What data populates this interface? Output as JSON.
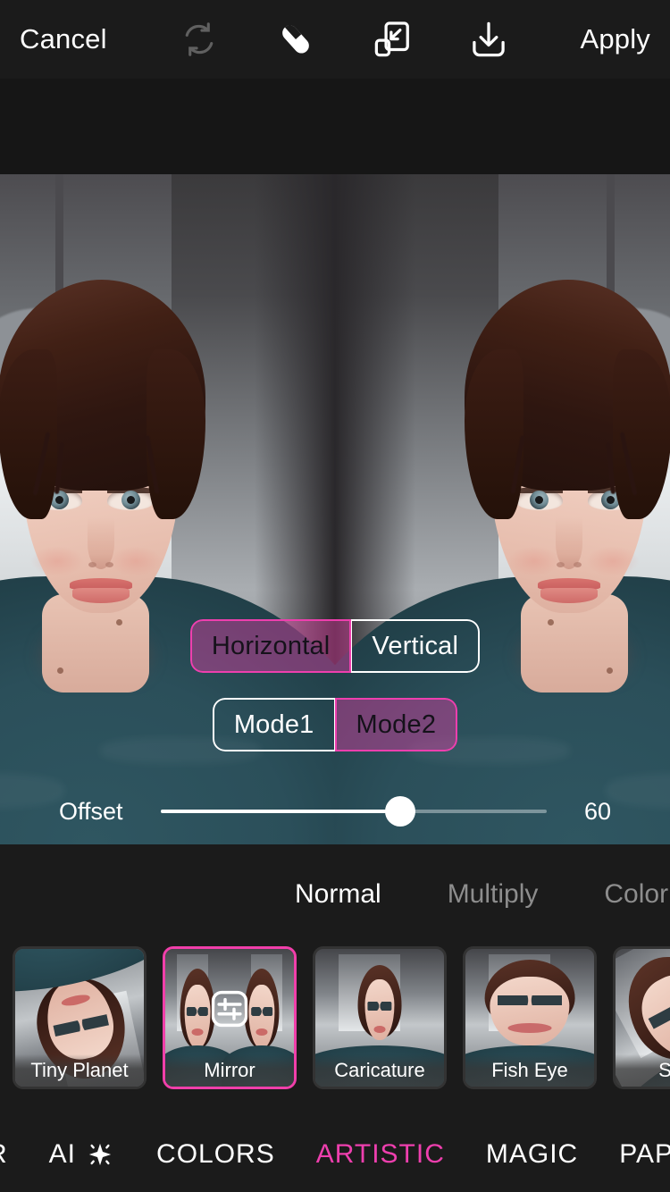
{
  "topbar": {
    "cancel_label": "Cancel",
    "apply_label": "Apply",
    "icons": [
      {
        "name": "reset-icon",
        "disabled": true
      },
      {
        "name": "eraser-icon",
        "disabled": false
      },
      {
        "name": "resize-icon",
        "disabled": false
      },
      {
        "name": "download-icon",
        "disabled": false
      }
    ]
  },
  "editor": {
    "effect_name": "Mirror",
    "orientation": {
      "options": [
        "Horizontal",
        "Vertical"
      ],
      "selected": "Horizontal"
    },
    "mode": {
      "options": [
        "Mode1",
        "Mode2"
      ],
      "selected": "Mode2"
    },
    "offset": {
      "label": "Offset",
      "value": 60,
      "display_value": "60",
      "min": 0,
      "max": 100,
      "percent": 62
    }
  },
  "blend_modes": {
    "items": [
      "Normal",
      "Multiply",
      "Color Bu"
    ],
    "selected": "Normal"
  },
  "filters": [
    {
      "label": "Tiny Planet",
      "selected": false
    },
    {
      "label": "Mirror",
      "selected": true,
      "badge": "sliders-icon"
    },
    {
      "label": "Caricature",
      "selected": false
    },
    {
      "label": "Fish Eye",
      "selected": false
    },
    {
      "label": "Swirl",
      "selected": false
    }
  ],
  "bottom_nav": {
    "items": [
      {
        "label": "R",
        "active": false,
        "icon": null
      },
      {
        "label": "AI",
        "active": false,
        "icon": "sparkle-icon"
      },
      {
        "label": "COLORS",
        "active": false,
        "icon": null
      },
      {
        "label": "ARTISTIC",
        "active": true,
        "icon": null
      },
      {
        "label": "MAGIC",
        "active": false,
        "icon": null
      },
      {
        "label": "PAPER",
        "active": false,
        "icon": null
      }
    ]
  },
  "colors": {
    "accent_pink": "#ee3fae",
    "selection_pink": "#f03faa",
    "bar_background": "#1b1b1b",
    "text_primary": "#ffffff",
    "text_dim": "#8d8d8d"
  }
}
